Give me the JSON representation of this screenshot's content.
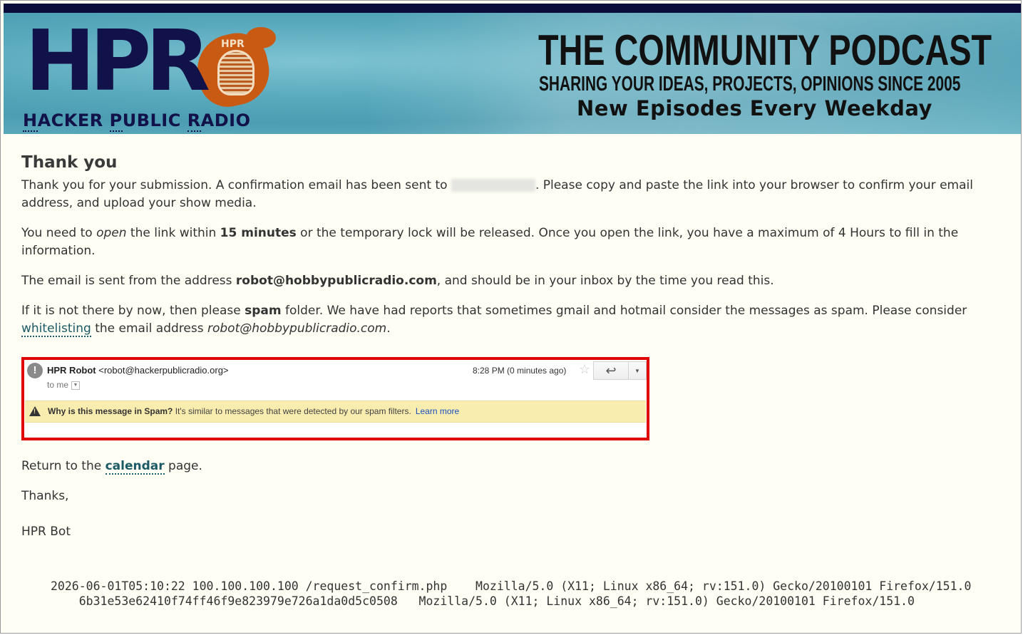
{
  "header": {
    "logo_main": "HPR",
    "logo_mic_label": "HPR",
    "logo_sub_1": "H",
    "logo_sub_2": "ACKER ",
    "logo_sub_3": "P",
    "logo_sub_4": "UBLIC ",
    "logo_sub_5": "R",
    "logo_sub_6": "ADIO",
    "tagline_1": "THE COMMUNITY PODCAST",
    "tagline_2": "SHARING YOUR IDEAS, PROJECTS, OPINIONS SINCE 2005",
    "tagline_3": "New Episodes Every Weekday"
  },
  "main": {
    "title": "Thank you",
    "p1_before": "Thank you for your submission. A confirmation email has been sent to ",
    "p1_after": ". Please copy and paste the link into your browser to confirm your email address, and upload your show media.",
    "p2_a": "You need to ",
    "p2_open": "open",
    "p2_b": " the link within ",
    "p2_minutes": "15 minutes",
    "p2_c": " or the temporary lock will be released. Once you open the link, you have a maximum of 4 Hours to fill in the information.",
    "p3_a": "The email is sent from the address ",
    "p3_email": "robot@hobbypublicradio.com",
    "p3_b": ", and should be in your inbox by the time you read this.",
    "p4_a": "If it is not there by now, then please ",
    "p4_spam": "spam",
    "p4_b": " folder. We have had reports that sometimes gmail and hotmail consider the messages as spam. Please consider ",
    "p4_link": "whitelisting",
    "p4_c": " the email address ",
    "p4_email": "robot@hobbypublicradio.com",
    "p4_d": "."
  },
  "screenshot": {
    "exclaim": "!",
    "sender_name": "HPR Robot",
    "sender_addr": " <robot@hackerpublicradio.org>",
    "to_me": "to me",
    "time": "8:28 PM (0 minutes ago)",
    "star": "☆",
    "reply": "↩",
    "more": "▼",
    "warning_bold": "Why is this message in Spam?",
    "warning_text": " It's similar to messages that were detected by our spam filters.",
    "learn_more": "Learn more"
  },
  "after": {
    "return_a": "Return to the ",
    "return_link": "calendar",
    "return_b": " page.",
    "thanks": "Thanks,",
    "signature": "HPR Bot"
  },
  "footer": {
    "line1": "2026-06-01T05:10:22 100.100.100.100 /request_confirm.php    Mozilla/5.0 (X11; Linux x86_64; rv:151.0) Gecko/20100101 Firefox/151.0",
    "line2": "    6b31e53e62410f74ff46f9e823979e726a1da0d5c0508   Mozilla/5.0 (X11; Linux x86_64; rv:151.0) Gecko/20100101 Firefox/151.0"
  }
}
